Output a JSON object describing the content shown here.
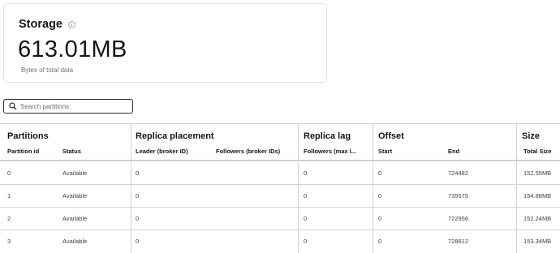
{
  "storage_card": {
    "title": "Storage",
    "value": "613.01MB",
    "subtitle": "Bytes of total data"
  },
  "search": {
    "placeholder": "Search partitions"
  },
  "table": {
    "groups": {
      "partitions": "Partitions",
      "replica_placement": "Replica placement",
      "replica_lag": "Replica lag",
      "offset": "Offset",
      "size": "Size"
    },
    "columns": {
      "partition_id": "Partition id",
      "status": "Status",
      "leader": "Leader (broker ID)",
      "followers": "Followers (broker IDs)",
      "followers_lag": "Followers (max l...",
      "start": "Start",
      "end": "End",
      "total_size": "Total Size"
    },
    "rows": [
      {
        "id": "0",
        "status": "Available",
        "leader": "0",
        "lag": "0",
        "start": "0",
        "end": "724482",
        "size": "152.55MB"
      },
      {
        "id": "1",
        "status": "Available",
        "leader": "0",
        "lag": "0",
        "start": "0",
        "end": "735575",
        "size": "154.88MB"
      },
      {
        "id": "2",
        "status": "Available",
        "leader": "0",
        "lag": "0",
        "start": "0",
        "end": "722956",
        "size": "152.24MB"
      },
      {
        "id": "3",
        "status": "Available",
        "leader": "0",
        "lag": "0",
        "start": "0",
        "end": "728612",
        "size": "153.34MB"
      }
    ]
  }
}
